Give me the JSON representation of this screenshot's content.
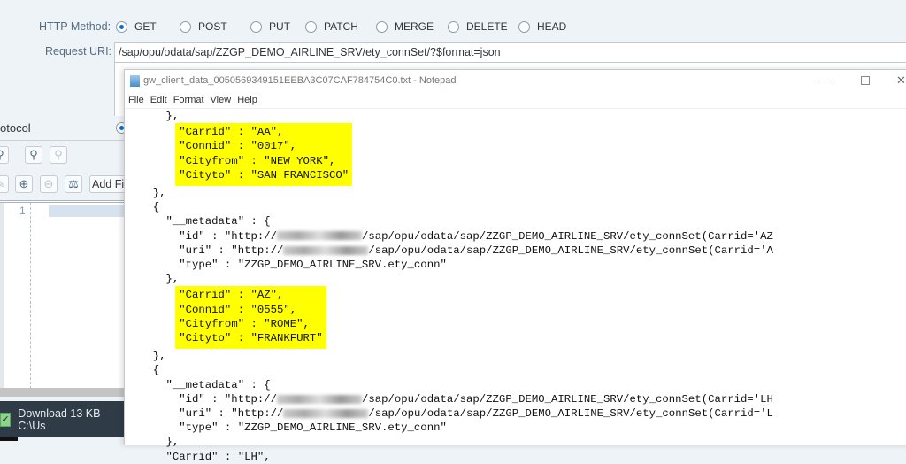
{
  "form": {
    "http_method_label": "HTTP Method:",
    "methods": [
      "GET",
      "POST",
      "PUT",
      "PATCH",
      "MERGE",
      "DELETE",
      "HEAD"
    ],
    "selected_method": "GET",
    "request_uri_label": "Request URI:",
    "request_uri": "/sap/opu/odata/sap/ZZGP_DEMO_AIRLINE_SRV/ety_connSet/?$format=json",
    "protocol_label": "otocol"
  },
  "toolbar": {
    "add_file_label": "Add Fil"
  },
  "editor": {
    "line_number": "1"
  },
  "status": {
    "text": "Download 13 KB C:\\Us"
  },
  "notepad": {
    "title": "gw_client_data_0050569349151EEBA3C07CAF784754C0.txt - Notepad",
    "menu": [
      "File",
      "Edit",
      "Format",
      "View",
      "Help"
    ],
    "lines": {
      "l0": "    },",
      "h1": [
        "\"Carrid\" : \"AA\",",
        "\"Connid\" : \"0017\",",
        "\"Cityfrom\" : \"NEW YORK\",",
        "\"Cityto\" : \"SAN FRANCISCO\""
      ],
      "l5": "  },",
      "l6": "  {",
      "l7": "    \"__metadata\" : {",
      "id_prefix": "      \"id\" : \"http://",
      "id_suffix": "/sap/opu/odata/sap/ZZGP_DEMO_AIRLINE_SRV/ety_connSet(Carrid='AZ",
      "uri_prefix": "      \"uri\" : \"http://",
      "uri_suffix": "/sap/opu/odata/sap/ZZGP_DEMO_AIRLINE_SRV/ety_connSet(Carrid='A",
      "type": "      \"type\" : \"ZZGP_DEMO_AIRLINE_SRV.ety_conn\"",
      "l11": "    },",
      "h2": [
        "\"Carrid\" : \"AZ\",",
        "\"Connid\" : \"0555\",",
        "\"Cityfrom\" : \"ROME\",",
        "\"Cityto\" : \"FRANKFURT\""
      ],
      "l16": "  },",
      "l17": "  {",
      "l18": "    \"__metadata\" : {",
      "id2_suffix": "/sap/opu/odata/sap/ZZGP_DEMO_AIRLINE_SRV/ety_connSet(Carrid='LH",
      "uri2_suffix": "/sap/opu/odata/sap/ZZGP_DEMO_AIRLINE_SRV/ety_connSet(Carrid='L",
      "l22": "    },",
      "l23": "    \"Carrid\" : \"LH\","
    }
  },
  "colors": {
    "highlight": "#ffff00",
    "accent": "#0a6ed1",
    "status_bg": "#2f3c48"
  }
}
